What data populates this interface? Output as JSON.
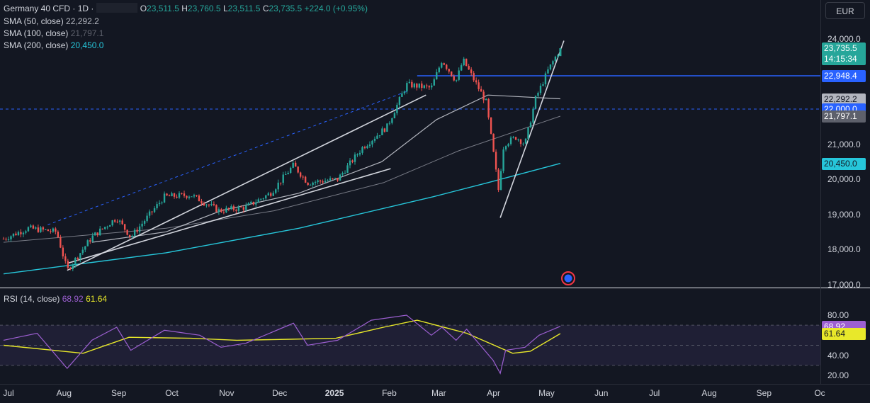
{
  "header": {
    "symbol": "Germany 40 CFD · 1D ·",
    "o_label": "O",
    "o_value": "23,511.5",
    "h_label": "H",
    "h_value": "23,760.5",
    "l_label": "L",
    "l_value": "23,511.5",
    "c_label": "C",
    "c_value": "23,735.5",
    "change": "+224.0 (+0.95%)"
  },
  "indicators": [
    {
      "label": "SMA (50, close)",
      "value": "22,292.2",
      "color": "#b2b5be"
    },
    {
      "label": "SMA (100, close)",
      "value": "21,797.1",
      "color": "#5d606b"
    },
    {
      "label": "SMA (200, close)",
      "value": "20,450.0",
      "color": "#26c6da"
    }
  ],
  "currency": "EUR",
  "price_axis": {
    "ticks": [
      "24,000.0",
      "23,000.0",
      "22,000.0",
      "21,000.0",
      "20,000.0",
      "19,000.0",
      "18,000.0",
      "17,000.0"
    ]
  },
  "price_tags": [
    {
      "text": "23,735.5",
      "sub": "14:15:34",
      "bg": "#26a69a",
      "fg": "#ffffff"
    },
    {
      "text": "22,948.4",
      "bg": "#2962ff",
      "fg": "#ffffff"
    },
    {
      "text": "22,292.2",
      "bg": "#b2b5be",
      "fg": "#131722"
    },
    {
      "text": "22,000.0",
      "bg": "#2962ff",
      "fg": "#ffffff"
    },
    {
      "text": "21,797.1",
      "bg": "#5d606b",
      "fg": "#ffffff"
    },
    {
      "text": "20,450.0",
      "bg": "#26c6da",
      "fg": "#131722"
    }
  ],
  "rsi": {
    "label": "RSI (14, close)",
    "value": "68.92",
    "ma_value": "61.64",
    "rsi_color": "#9c5fd1",
    "ma_color": "#e8e82a",
    "ticks": [
      "80.00",
      "40.00",
      "20.00"
    ],
    "tags": [
      {
        "text": "68.92",
        "bg": "#9c5fd1",
        "fg": "#ffffff"
      },
      {
        "text": "61.64",
        "bg": "#e8e82a",
        "fg": "#131722"
      }
    ]
  },
  "time_axis": [
    "Jul",
    "Aug",
    "Sep",
    "Oct",
    "Nov",
    "Dec",
    "2025",
    "Feb",
    "Mar",
    "Apr",
    "May",
    "Jun",
    "Jul",
    "Aug",
    "Sep",
    "Oc"
  ],
  "chart_data": {
    "type": "candlestick",
    "instrument": "Germany 40 CFD",
    "interval": "1D",
    "ylim": [
      17000,
      24000
    ],
    "close_path": [
      {
        "date": "2024-07-01",
        "close": 18300
      },
      {
        "date": "2024-07-15",
        "close": 18600
      },
      {
        "date": "2024-07-31",
        "close": 18500
      },
      {
        "date": "2024-08-06",
        "close": 17400
      },
      {
        "date": "2024-08-20",
        "close": 18350
      },
      {
        "date": "2024-09-03",
        "close": 18900
      },
      {
        "date": "2024-09-11",
        "close": 18350
      },
      {
        "date": "2024-09-30",
        "close": 19500
      },
      {
        "date": "2024-10-15",
        "close": 19550
      },
      {
        "date": "2024-10-31",
        "close": 19100
      },
      {
        "date": "2024-11-15",
        "close": 19200
      },
      {
        "date": "2024-11-29",
        "close": 19600
      },
      {
        "date": "2024-12-12",
        "close": 20400
      },
      {
        "date": "2024-12-20",
        "close": 19900
      },
      {
        "date": "2025-01-06",
        "close": 20000
      },
      {
        "date": "2025-01-20",
        "close": 20900
      },
      {
        "date": "2025-02-03",
        "close": 21500
      },
      {
        "date": "2025-02-14",
        "close": 22700
      },
      {
        "date": "2025-02-28",
        "close": 22600
      },
      {
        "date": "2025-03-06",
        "close": 23400
      },
      {
        "date": "2025-03-14",
        "close": 22800
      },
      {
        "date": "2025-03-18",
        "close": 23400
      },
      {
        "date": "2025-03-31",
        "close": 22200
      },
      {
        "date": "2025-04-04",
        "close": 20800
      },
      {
        "date": "2025-04-07",
        "close": 19700
      },
      {
        "date": "2025-04-10",
        "close": 21000
      },
      {
        "date": "2025-04-17",
        "close": 21200
      },
      {
        "date": "2025-04-22",
        "close": 21000
      },
      {
        "date": "2025-04-28",
        "close": 22300
      },
      {
        "date": "2025-05-05",
        "close": 23100
      },
      {
        "date": "2025-05-12",
        "close": 23735.5
      }
    ],
    "sma50": [
      {
        "date": "2024-08-20",
        "v": 18200
      },
      {
        "date": "2024-10-01",
        "v": 18500
      },
      {
        "date": "2024-11-01",
        "v": 19100
      },
      {
        "date": "2024-12-15",
        "v": 19600
      },
      {
        "date": "2025-01-31",
        "v": 20500
      },
      {
        "date": "2025-03-03",
        "v": 21700
      },
      {
        "date": "2025-04-01",
        "v": 22400
      },
      {
        "date": "2025-05-12",
        "v": 22292.2
      }
    ],
    "sma100": [
      {
        "date": "2024-07-01",
        "v": 18200
      },
      {
        "date": "2024-10-01",
        "v": 18600
      },
      {
        "date": "2024-12-01",
        "v": 19100
      },
      {
        "date": "2025-02-01",
        "v": 19900
      },
      {
        "date": "2025-03-15",
        "v": 20800
      },
      {
        "date": "2025-05-12",
        "v": 21797.1
      }
    ],
    "sma200": [
      {
        "date": "2024-07-01",
        "v": 17300
      },
      {
        "date": "2024-10-01",
        "v": 17900
      },
      {
        "date": "2024-12-15",
        "v": 18600
      },
      {
        "date": "2025-03-01",
        "v": 19500
      },
      {
        "date": "2025-04-01",
        "v": 19900
      },
      {
        "date": "2025-05-12",
        "v": 20450.0
      }
    ],
    "rsi14": [
      {
        "date": "2024-07-01",
        "v": 55
      },
      {
        "date": "2024-07-20",
        "v": 62
      },
      {
        "date": "2024-08-06",
        "v": 27
      },
      {
        "date": "2024-08-20",
        "v": 55
      },
      {
        "date": "2024-09-03",
        "v": 68
      },
      {
        "date": "2024-09-11",
        "v": 45
      },
      {
        "date": "2024-09-30",
        "v": 65
      },
      {
        "date": "2024-10-20",
        "v": 60
      },
      {
        "date": "2024-11-01",
        "v": 48
      },
      {
        "date": "2024-11-15",
        "v": 52
      },
      {
        "date": "2024-12-12",
        "v": 72
      },
      {
        "date": "2024-12-20",
        "v": 50
      },
      {
        "date": "2025-01-06",
        "v": 55
      },
      {
        "date": "2025-01-25",
        "v": 75
      },
      {
        "date": "2025-02-14",
        "v": 80
      },
      {
        "date": "2025-02-28",
        "v": 60
      },
      {
        "date": "2025-03-06",
        "v": 68
      },
      {
        "date": "2025-03-14",
        "v": 55
      },
      {
        "date": "2025-03-20",
        "v": 66
      },
      {
        "date": "2025-04-04",
        "v": 35
      },
      {
        "date": "2025-04-08",
        "v": 22
      },
      {
        "date": "2025-04-11",
        "v": 45
      },
      {
        "date": "2025-04-22",
        "v": 48
      },
      {
        "date": "2025-04-30",
        "v": 60
      },
      {
        "date": "2025-05-12",
        "v": 68.92
      }
    ],
    "rsi_ma": [
      {
        "date": "2024-07-01",
        "v": 50
      },
      {
        "date": "2024-08-15",
        "v": 42
      },
      {
        "date": "2024-09-10",
        "v": 58
      },
      {
        "date": "2024-10-15",
        "v": 57
      },
      {
        "date": "2024-11-10",
        "v": 55
      },
      {
        "date": "2024-12-10",
        "v": 56
      },
      {
        "date": "2025-01-05",
        "v": 57
      },
      {
        "date": "2025-02-01",
        "v": 68
      },
      {
        "date": "2025-02-20",
        "v": 75
      },
      {
        "date": "2025-03-20",
        "v": 62
      },
      {
        "date": "2025-04-15",
        "v": 42
      },
      {
        "date": "2025-04-25",
        "v": 44
      },
      {
        "date": "2025-05-12",
        "v": 61.64
      }
    ],
    "rsi_range": [
      10,
      90
    ],
    "horizontal_lines": [
      {
        "value": 22948.4,
        "style": "solid",
        "color": "#2962ff"
      },
      {
        "value": 22000.0,
        "style": "dashed",
        "color": "#2962ff"
      }
    ],
    "trend_lines": [
      {
        "from": {
          "date": "2024-08-06",
          "v": 17400
        },
        "to": {
          "date": "2025-02-25",
          "v": 22400
        }
      },
      {
        "from": {
          "date": "2024-07-26",
          "v": 18700
        },
        "to": {
          "date": "2025-02-14",
          "v": 22500
        }
      },
      {
        "from": {
          "date": "2024-08-06",
          "v": 17600
        },
        "to": {
          "date": "2025-02-05",
          "v": 20300
        }
      },
      {
        "from": {
          "date": "2025-04-08",
          "v": 18900
        },
        "to": {
          "date": "2025-05-14",
          "v": 23950
        }
      }
    ],
    "grid": false,
    "legend": "top-left"
  }
}
